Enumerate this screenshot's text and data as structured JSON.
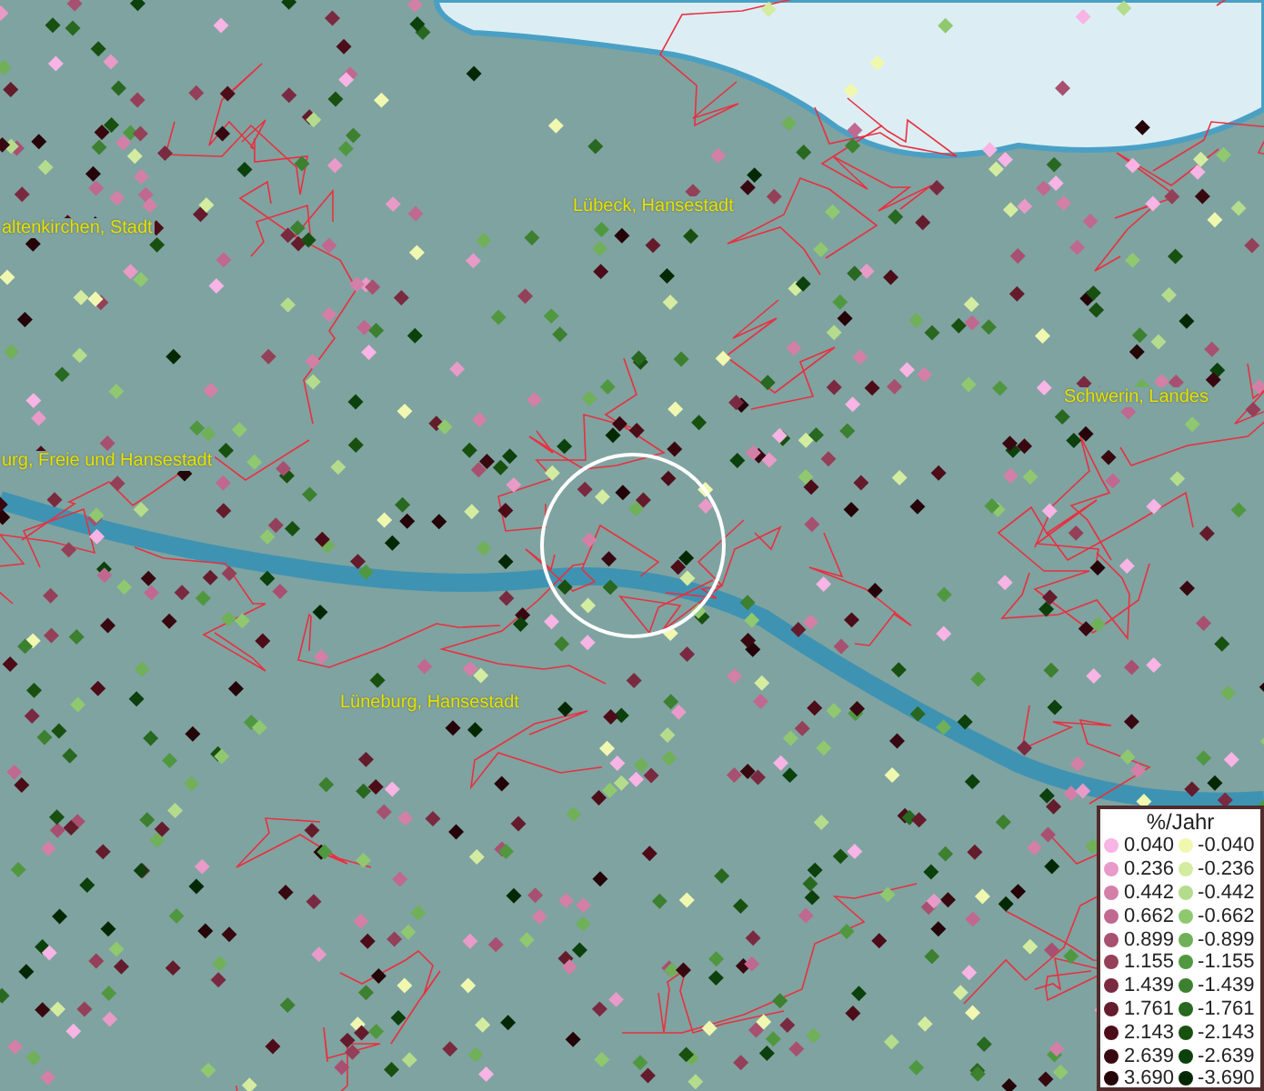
{
  "map_labels": [
    "altenkirchen, Stadt",
    "Lübeck, Hansestadt",
    "Schwerin, Landes",
    "urg, Freie und Hansestadt",
    "Lüneburg, Hansestadt"
  ],
  "legend": {
    "title": "%/Jahr",
    "positive": [
      {
        "label": "0.040",
        "color": "#f8b4e4"
      },
      {
        "label": "0.236",
        "color": "#e89ac8"
      },
      {
        "label": "0.442",
        "color": "#d47fa8"
      },
      {
        "label": "0.662",
        "color": "#c06890"
      },
      {
        "label": "0.899",
        "color": "#a85070"
      },
      {
        "label": "1.155",
        "color": "#944058"
      },
      {
        "label": "1.439",
        "color": "#7a2a40"
      },
      {
        "label": "1.761",
        "color": "#641c2c"
      },
      {
        "label": "2.143",
        "color": "#4c0c18"
      },
      {
        "label": "2.639",
        "color": "#380810"
      },
      {
        "label": "3.690",
        "color": "#240408"
      }
    ],
    "negative": [
      {
        "label": "-0.040",
        "color": "#f0f8b0"
      },
      {
        "label": "-0.236",
        "color": "#d4eca0"
      },
      {
        "label": "-0.442",
        "color": "#b4dc8c"
      },
      {
        "label": "-0.662",
        "color": "#90c870"
      },
      {
        "label": "-0.899",
        "color": "#70b058"
      },
      {
        "label": "-1.155",
        "color": "#509840"
      },
      {
        "label": "-1.439",
        "color": "#3c8030"
      },
      {
        "label": "-1.761",
        "color": "#286820"
      },
      {
        "label": "-2.143",
        "color": "#185010"
      },
      {
        "label": "-2.639",
        "color": "#0c400c"
      },
      {
        "label": "-3.690",
        "color": "#042804"
      }
    ]
  }
}
